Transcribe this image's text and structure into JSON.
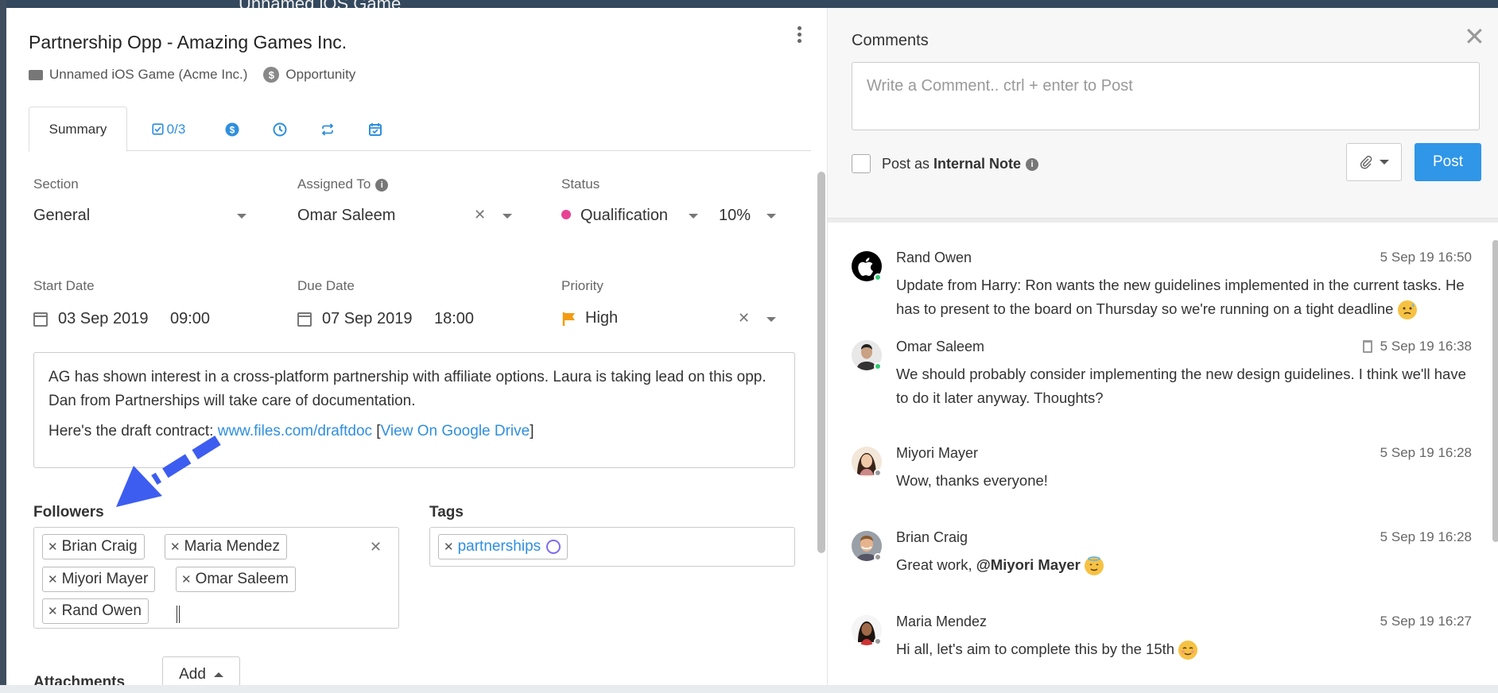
{
  "background": {
    "app_title": "Unnamed iOS Game"
  },
  "task": {
    "title": "Partnership Opp - Amazing Games Inc.",
    "project": "Unnamed iOS Game (Acme Inc.)",
    "type": "Opportunity"
  },
  "tabs": [
    {
      "label": "Summary",
      "icon": "none"
    },
    {
      "label": "0/3",
      "icon": "checkbox-icon"
    },
    {
      "label": "",
      "icon": "dollar-coin-icon"
    },
    {
      "label": "",
      "icon": "clock-icon"
    },
    {
      "label": "",
      "icon": "repeat-icon"
    },
    {
      "label": "",
      "icon": "calendar-check-icon"
    }
  ],
  "fields": {
    "section": {
      "label": "Section",
      "value": "General"
    },
    "assigned_to": {
      "label": "Assigned To",
      "value": "Omar Saleem"
    },
    "status": {
      "label": "Status",
      "value": "Qualification",
      "percent": "10%",
      "color": "#e84393"
    },
    "start_date": {
      "label": "Start Date",
      "date": "03 Sep 2019",
      "time": "09:00"
    },
    "due_date": {
      "label": "Due Date",
      "date": "07 Sep 2019",
      "time": "18:00"
    },
    "priority": {
      "label": "Priority",
      "value": "High",
      "color": "#f39c12"
    }
  },
  "description": {
    "line1": "AG has shown interest in a cross-platform partnership with affiliate options. Laura is taking lead on this opp. Dan from Partnerships will take care of documentation.",
    "line2_prefix": "Here's the draft contract: ",
    "link": "www.files.com/draftdoc",
    "bracket_open": " [",
    "drive_link": "View On Google Drive",
    "bracket_close": "]"
  },
  "followers": {
    "title": "Followers",
    "items": [
      "Brian Craig",
      "Maria Mendez",
      "Miyori Mayer",
      "Omar Saleem",
      "Rand Owen"
    ]
  },
  "tags": {
    "title": "Tags",
    "items": [
      "partnerships"
    ]
  },
  "attachments": {
    "title": "Attachments",
    "add_label": "Add"
  },
  "comments": {
    "title": "Comments",
    "placeholder": "Write a Comment.. ctrl + enter to Post",
    "internal_prefix": "Post as ",
    "internal_label": "Internal Note",
    "post_label": "Post",
    "items": [
      {
        "author": "Rand Owen",
        "time": "5 Sep 19 16:50",
        "text": "Update from Harry: Ron wants the new guidelines implemented in the current tasks. He has to present to the board on Thursday so we're running on a tight deadline",
        "online": "#2ecc71"
      },
      {
        "author": "Omar Saleem",
        "time": "5 Sep 19 16:38",
        "text": "We should probably consider implementing the new design guidelines. I think we'll have to do it later anyway. Thoughts?",
        "online": "#2ecc71"
      },
      {
        "author": "Miyori Mayer",
        "time": "5 Sep 19 16:28",
        "text": "Wow, thanks everyone!",
        "online": "#999999"
      },
      {
        "author": "Brian Craig",
        "time": "5 Sep 19 16:28",
        "text_prefix": "Great work, ",
        "mention": "@Miyori Mayer",
        "online": "#999999"
      },
      {
        "author": "Maria Mendez",
        "time": "5 Sep 19 16:27",
        "text": "Hi all, let's aim to complete this by the 15th",
        "online": "#999999"
      }
    ]
  }
}
